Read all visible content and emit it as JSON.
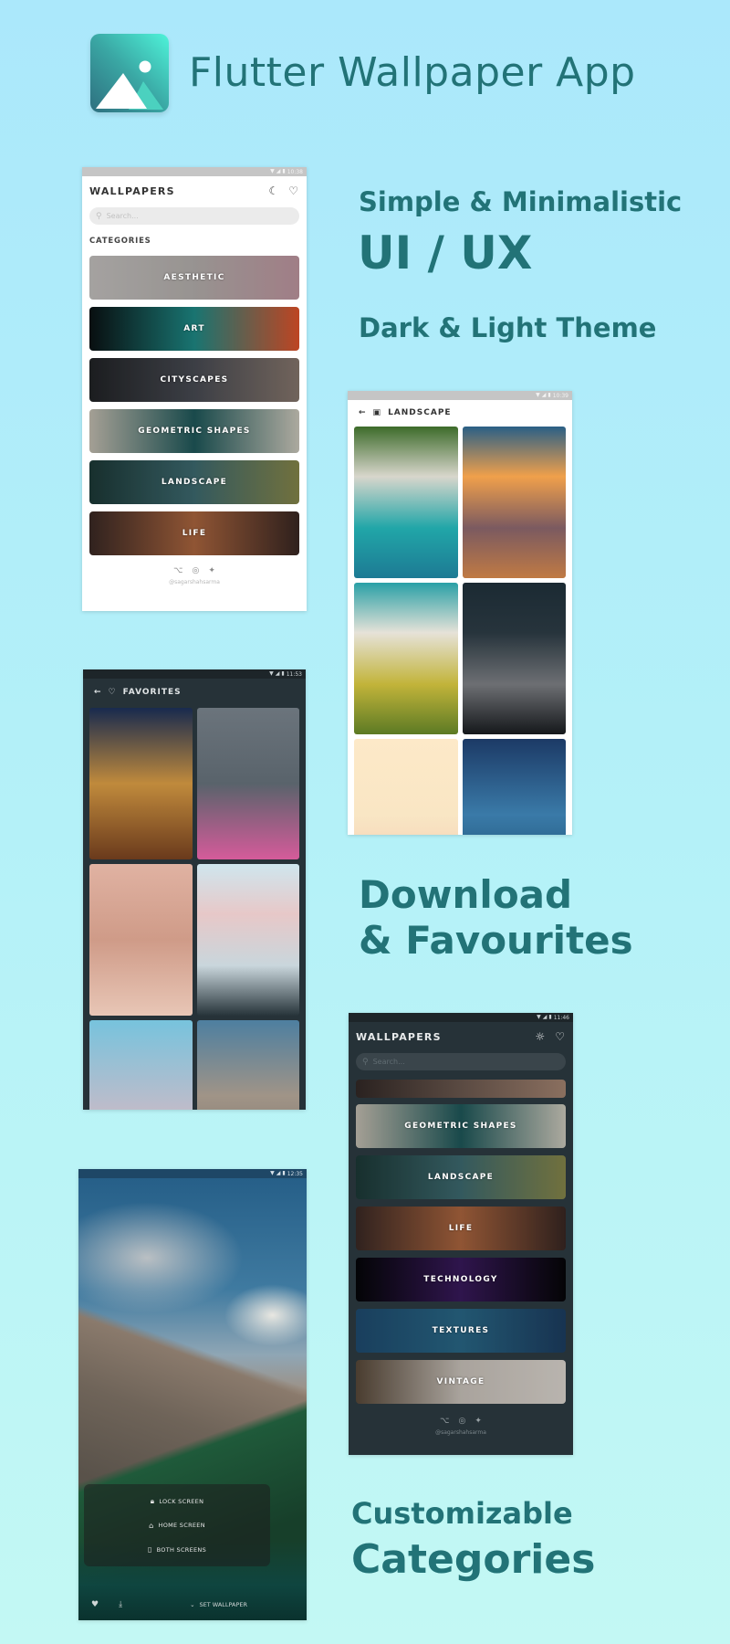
{
  "header": {
    "title": "Flutter Wallpaper App",
    "logo_icon": "image-landscape-icon",
    "logo_gradient": [
      "#2e6f7f",
      "#4ef3d9"
    ]
  },
  "theme": {
    "text_color": "#227377",
    "background": [
      "#abe8fb",
      "#c3f8f4"
    ]
  },
  "features": {
    "simple": "Simple & Minimalistic",
    "uiux": "UI / UX",
    "theme": "Dark & Light Theme",
    "download_line1": "Download",
    "download_line2": "& Favourites",
    "customizable": "Customizable",
    "categories": "Categories"
  },
  "status_icons": {
    "wifi": "▼",
    "signal": "◢",
    "battery": "▮"
  },
  "phone_light_home": {
    "time": "10:38",
    "title": "WALLPAPERS",
    "theme_toggle_icon": "moon-icon",
    "favorites_icon": "heart-icon",
    "search_placeholder": "Search...",
    "section_label": "CATEGORIES",
    "categories": [
      {
        "label": "AESTHETIC",
        "colors": [
          "#c9c6c4",
          "#b9b4b1",
          "#c49aa4"
        ]
      },
      {
        "label": "ART",
        "colors": [
          "#0b1214",
          "#1f8e8a",
          "#e7552b"
        ]
      },
      {
        "label": "CITYSCAPES",
        "colors": [
          "#222427",
          "#4a4d55",
          "#8a7a70"
        ]
      },
      {
        "label": "GEOMETRIC SHAPES",
        "colors": [
          "#c9c3b6",
          "#1f5a5c",
          "#d2cfc2"
        ]
      },
      {
        "label": "LANDSCAPE",
        "colors": [
          "#1d3a38",
          "#3f6d73",
          "#8a8a4c"
        ]
      },
      {
        "label": "LIFE",
        "colors": [
          "#3b2a26",
          "#b06840",
          "#3a2824"
        ]
      }
    ],
    "footer_icons": [
      "github-icon",
      "instagram-icon",
      "twitter-icon"
    ],
    "footer_handle": "@sagarshahsarma"
  },
  "phone_light_landscape": {
    "time": "10:39",
    "back_icon": "arrow-left-icon",
    "category_icon": "image-icon",
    "title": "LANDSCAPE",
    "tiles": [
      {
        "name": "aerial-beach-forest",
        "colors": [
          "#3d6b2a",
          "#d8d6cc",
          "#21a6a8",
          "#1d7a94"
        ]
      },
      {
        "name": "ocean-sunset",
        "colors": [
          "#2a5f86",
          "#f0a04b",
          "#7b5a60",
          "#c07a44"
        ]
      },
      {
        "name": "aerial-coast-village",
        "colors": [
          "#2aa0a6",
          "#e6e2d8",
          "#c2b43a",
          "#5c7a24"
        ]
      },
      {
        "name": "night-mountain-stars",
        "colors": [
          "#1b2a33",
          "#27343c",
          "#6d6f73",
          "#15181b"
        ]
      },
      {
        "name": "pastel-hills",
        "colors": [
          "#fde9c8",
          "#f9e6c4",
          "#f2c8b0"
        ]
      },
      {
        "name": "blue-volcano-night",
        "colors": [
          "#1c3a66",
          "#3a7aa8",
          "#174a6a"
        ]
      }
    ]
  },
  "phone_dark_favorites": {
    "time": "11:53",
    "back_icon": "arrow-left-icon",
    "heart_icon": "heart-icon",
    "title": "FAVORITES",
    "tiles": [
      {
        "name": "eiffel-tower-night",
        "colors": [
          "#182a4e",
          "#c08a3c",
          "#6a3a1c"
        ]
      },
      {
        "name": "pink-flower-hand",
        "colors": [
          "#6b747c",
          "#59636b",
          "#d55b9a"
        ]
      },
      {
        "name": "pink-paint-texture",
        "colors": [
          "#e0b2a2",
          "#cf9b88",
          "#e8c6b6"
        ]
      },
      {
        "name": "snowy-mountains-dusk",
        "colors": [
          "#cfe6ee",
          "#e7c8c8",
          "#c9d6dc",
          "#27343a"
        ]
      },
      {
        "name": "pastel-sky-gradient",
        "colors": [
          "#77c3dd",
          "#f0b7bd"
        ]
      },
      {
        "name": "mountain-clouds",
        "colors": [
          "#4d7fa0",
          "#a09487",
          "#7a6f66"
        ]
      }
    ]
  },
  "phone_dark_home": {
    "time": "11:46",
    "title": "WALLPAPERS",
    "theme_toggle_icon": "sun-icon",
    "favorites_icon": "heart-icon",
    "search_placeholder": "Search...",
    "partial_category": {
      "label": "",
      "colors": [
        "#2a2220",
        "#5a4a42",
        "#8a6f5f"
      ]
    },
    "categories": [
      {
        "label": "GEOMETRIC SHAPES",
        "colors": [
          "#c9c3b6",
          "#1f5a5c",
          "#d2cfc2"
        ]
      },
      {
        "label": "LANDSCAPE",
        "colors": [
          "#1d3a38",
          "#3f6d73",
          "#8a8a4c"
        ]
      },
      {
        "label": "LIFE",
        "colors": [
          "#3b2a26",
          "#b06840",
          "#3a2824"
        ]
      },
      {
        "label": "TECHNOLOGY",
        "colors": [
          "#050608",
          "#3a1a5e",
          "#060608"
        ]
      },
      {
        "label": "TEXTURES",
        "colors": [
          "#1f4d72",
          "#2a6a8a",
          "#1d3f63"
        ]
      },
      {
        "label": "VINTAGE",
        "colors": [
          "#5a4a3a",
          "#cfc8c0",
          "#e2dcd5"
        ]
      }
    ],
    "footer_icons": [
      "github-icon",
      "instagram-icon",
      "twitter-icon"
    ],
    "footer_handle": "@sagarshahsarma"
  },
  "phone_detail": {
    "time": "12:35",
    "sheet_options": [
      {
        "icon": "lock-icon",
        "glyph": "🔒︎",
        "label": "LOCK SCREEN"
      },
      {
        "icon": "home-icon",
        "glyph": "⌂",
        "label": "HOME SCREEN"
      },
      {
        "icon": "phone-icon",
        "glyph": "▯",
        "label": "BOTH SCREENS"
      }
    ],
    "bottom": {
      "favorite_icon": "heart-icon",
      "download_icon": "download-icon",
      "set_icon": "chevron-down-icon",
      "set_label": "SET WALLPAPER"
    }
  }
}
